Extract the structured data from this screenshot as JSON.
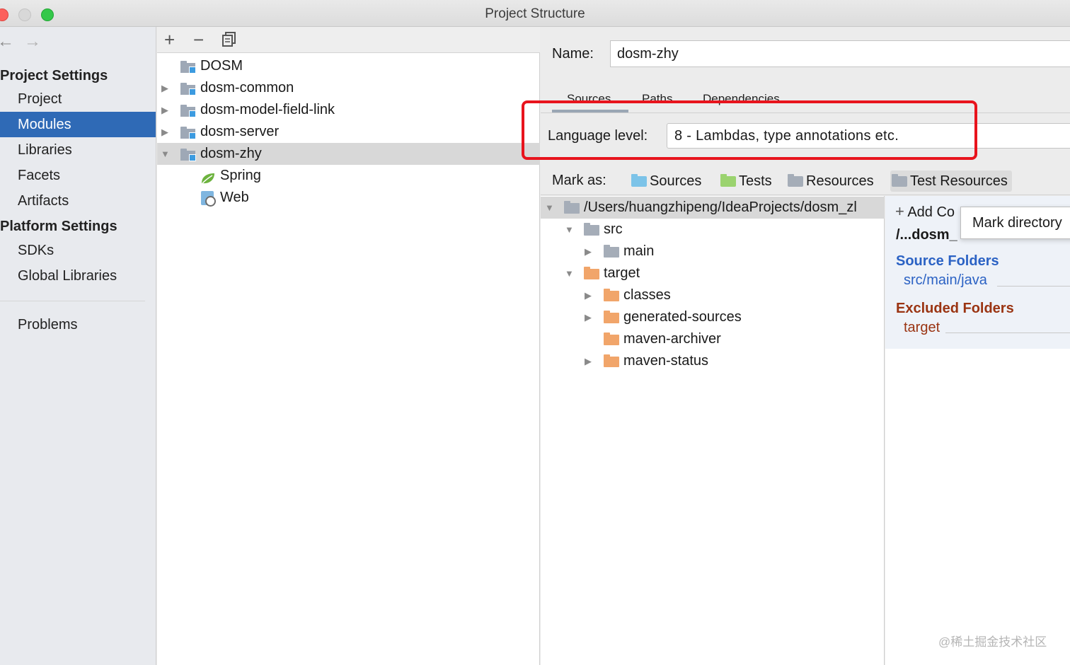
{
  "window": {
    "title": "Project Structure"
  },
  "nav": {
    "back_icon": "arrow-left-icon",
    "forward_icon": "arrow-right-icon"
  },
  "sidebar": {
    "project_heading": "Project Settings",
    "project_items": [
      {
        "label": "Project"
      },
      {
        "label": "Modules",
        "selected": true
      },
      {
        "label": "Libraries"
      },
      {
        "label": "Facets"
      },
      {
        "label": "Artifacts"
      }
    ],
    "platform_heading": "Platform Settings",
    "platform_items": [
      {
        "label": "SDKs"
      },
      {
        "label": "Global Libraries"
      }
    ],
    "problems": "Problems"
  },
  "modules_toolbar": {
    "add": "+",
    "remove": "−",
    "copy_icon": "copy-icon"
  },
  "module_tree": [
    {
      "label": "DOSM"
    },
    {
      "label": "dosm-common"
    },
    {
      "label": "dosm-model-field-link"
    },
    {
      "label": "dosm-server"
    },
    {
      "label": "dosm-zhy",
      "selected": true,
      "expanded": true
    },
    {
      "label": "Spring",
      "child": true
    },
    {
      "label": "Web",
      "child": true
    }
  ],
  "detail": {
    "name_label": "Name:",
    "name_value": "dosm-zhy",
    "tabs": [
      "Sources",
      "Paths",
      "Dependencies"
    ],
    "active_tab": "Sources",
    "language_label": "Language level:",
    "language_value": "8 - Lambdas, type annotations etc.",
    "mark_as_label": "Mark as:",
    "mark_buttons": [
      {
        "label": "Sources",
        "color": "#7cc3e8"
      },
      {
        "label": "Tests",
        "color": "#9bd36f"
      },
      {
        "label": "Resources",
        "color": "#a5adb8"
      },
      {
        "label": "Test Resources",
        "color": "#a5adb8"
      }
    ]
  },
  "content_tree": [
    {
      "label": "/Users/huangzhipeng/IdeaProjects/dosm_zl",
      "type": "grey",
      "selected": true
    },
    {
      "label": "src",
      "type": "grey"
    },
    {
      "label": "main",
      "type": "grey"
    },
    {
      "label": "target",
      "type": "orange"
    },
    {
      "label": "classes",
      "type": "orange"
    },
    {
      "label": "generated-sources",
      "type": "orange"
    },
    {
      "label": "maven-archiver",
      "type": "orange"
    },
    {
      "label": "maven-status",
      "type": "orange"
    }
  ],
  "roots": {
    "add_root": "Add Co",
    "root_path": "/...dosm_",
    "source_folders_heading": "Source Folders",
    "source_folders": [
      "src/main/java"
    ],
    "excluded_heading": "Excluded Folders",
    "excluded": [
      "target"
    ],
    "tooltip": "Mark directory",
    "source_color": "#2b62c4",
    "excluded_color": "#9a3412"
  },
  "highlight_color": "#e8141d",
  "watermark": "@稀土掘金技术社区"
}
